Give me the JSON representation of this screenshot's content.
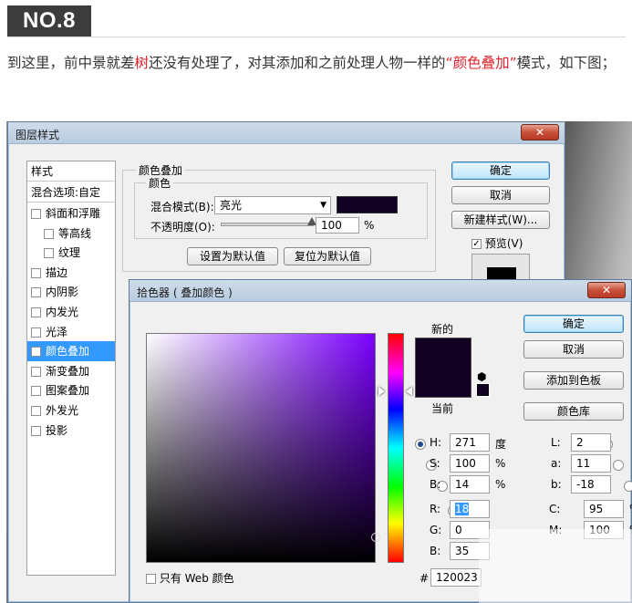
{
  "header": {
    "badge": "NO.8",
    "intro_before": "到这里，前中景就差",
    "intro_red1": "树",
    "intro_mid": "还没有处理了，对其添加和之前处理人物一样的",
    "intro_red2": "“颜色叠加”",
    "intro_after": "模式，如下图；"
  },
  "layer_style": {
    "title": "图层样式",
    "close": "✕",
    "list_header": "样式",
    "blend_options": "混合选项:自定",
    "items": [
      {
        "label": "斜面和浮雕",
        "checked": false
      },
      {
        "label": "等高线",
        "checked": false
      },
      {
        "label": "纹理",
        "checked": false
      },
      {
        "label": "描边",
        "checked": false
      },
      {
        "label": "内阴影",
        "checked": false
      },
      {
        "label": "内发光",
        "checked": false
      },
      {
        "label": "光泽",
        "checked": false
      },
      {
        "label": "颜色叠加",
        "checked": true
      },
      {
        "label": "渐变叠加",
        "checked": false
      },
      {
        "label": "图案叠加",
        "checked": false
      },
      {
        "label": "外发光",
        "checked": false
      },
      {
        "label": "投影",
        "checked": false
      }
    ],
    "group_title": "颜色叠加",
    "subgroup_title": "颜色",
    "blend_mode_label": "混合模式(B):",
    "blend_mode_value": "亮光",
    "opacity_label": "不透明度(O):",
    "opacity_value": "100",
    "opacity_unit": "%",
    "opacity_level": 1.0,
    "set_default": "设置为默认值",
    "reset_default": "复位为默认值",
    "ok": "确定",
    "cancel": "取消",
    "new_style": "新建样式(W)...",
    "preview": "预览(V)",
    "overlay_color": "#120023"
  },
  "color_picker": {
    "title": "拾色器 ( 叠加颜色 )",
    "close": "✕",
    "new_label": "新的",
    "current_label": "当前",
    "ok": "确定",
    "cancel": "取消",
    "add_swatch": "添加到色板",
    "color_libraries": "颜色库",
    "web_only": "只有 Web 颜色",
    "hsb": [
      {
        "label": "H:",
        "value": "271",
        "unit": "度",
        "selected": true
      },
      {
        "label": "S:",
        "value": "100",
        "unit": "%",
        "selected": false
      },
      {
        "label": "B:",
        "value": "14",
        "unit": "%",
        "selected": false
      }
    ],
    "rgb": [
      {
        "label": "R:",
        "value": "18"
      },
      {
        "label": "G:",
        "value": "0"
      },
      {
        "label": "B:",
        "value": "35"
      }
    ],
    "lab": [
      {
        "label": "L:",
        "value": "2"
      },
      {
        "label": "a:",
        "value": "11"
      },
      {
        "label": "b:",
        "value": "-18"
      }
    ],
    "cmyk": [
      {
        "label": "C:",
        "value": "95",
        "unit": "%"
      },
      {
        "label": "M:",
        "value": "100",
        "unit": "%"
      }
    ],
    "hex_label": "#",
    "hex_value": "120023",
    "new_color": "#120023",
    "current_color": "#120023"
  }
}
